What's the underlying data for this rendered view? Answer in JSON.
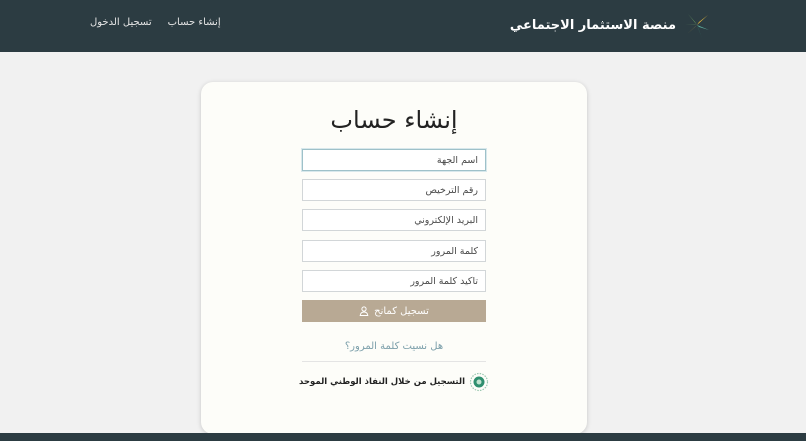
{
  "header": {
    "brand_name": "منصة الاستثمار الاجتماعي",
    "nav": {
      "create_account": "إنشاء حساب",
      "login": "تسجيل الدخول"
    }
  },
  "form": {
    "title": "إنشاء حساب",
    "fields": {
      "entity_name": "اسم الجهة",
      "license_number": "رقم الترخيص",
      "email": "البريد الإلكتروني",
      "password": "كلمة المرور",
      "confirm_password": "تاكيد كلمة المرور"
    },
    "submit_label": "تسجيل كمانح",
    "forgot_password": "هل نسيت كلمة المرور؟",
    "nafath_label": "التسجيل من خلال النفاذ الوطني الموحد"
  },
  "colors": {
    "header_bg": "#2c3c42",
    "button_bg": "#b8a994",
    "link": "#7da0ab"
  },
  "icons": [
    "brand-logo-icon",
    "user-icon",
    "nafath-icon"
  ]
}
